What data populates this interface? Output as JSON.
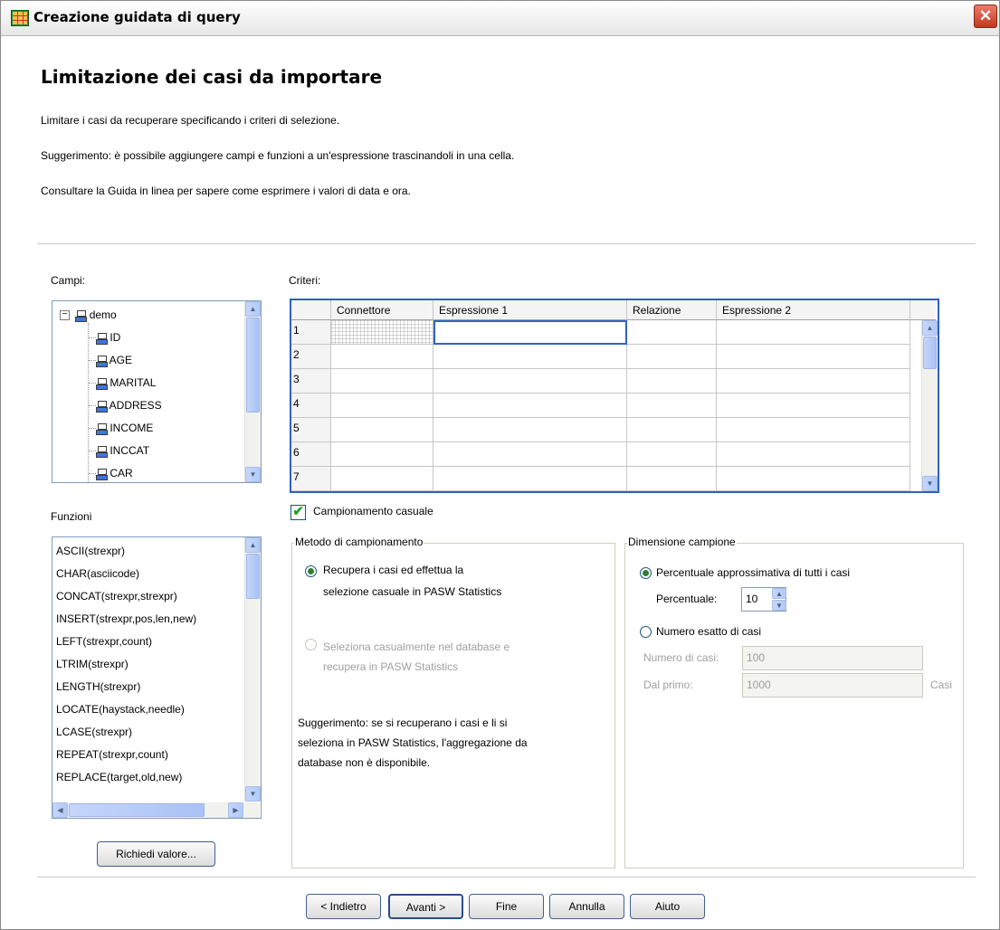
{
  "window": {
    "title": "Creazione guidata di query",
    "close_glyph": "✕"
  },
  "page": {
    "heading": "Limitazione dei casi da importare",
    "desc1": "Limitare i casi da recuperare specificando i criteri di selezione.",
    "desc2": "Suggerimento: è possibile aggiungere campi e funzioni a un'espressione trascinandoli in una cella.",
    "desc3": "Consultare la Guida in linea per sapere come esprimere i valori di data e ora."
  },
  "fields": {
    "label": "Campi:",
    "root": "demo",
    "items": [
      "ID",
      "AGE",
      "MARITAL",
      "ADDRESS",
      "INCOME",
      "INCCAT",
      "CAR"
    ]
  },
  "functions": {
    "label": "Funzioni",
    "items": [
      "ASCII(strexpr)",
      "CHAR(asciicode)",
      "CONCAT(strexpr,strexpr)",
      "INSERT(strexpr,pos,len,new)",
      "LEFT(strexpr,count)",
      "LTRIM(strexpr)",
      "LENGTH(strexpr)",
      "LOCATE(haystack,needle)",
      "LCASE(strexpr)",
      "REPEAT(strexpr,count)",
      "REPLACE(target,old,new)"
    ],
    "value_button": "Richiedi valore..."
  },
  "criteria": {
    "label": "Criteri:",
    "columns": [
      "Connettore",
      "Espressione 1",
      "Relazione",
      "Espressione 2"
    ],
    "rows": [
      "1",
      "2",
      "3",
      "4",
      "5",
      "6",
      "7"
    ]
  },
  "sampling": {
    "checkbox_label": "Campionamento casuale",
    "checked": true,
    "method": {
      "title": "Metodo di campionamento",
      "option1_line1": "Recupera i casi ed effettua la",
      "option1_line2": "selezione casuale in PASW Statistics",
      "option2_line1": "Seleziona casualmente nel database e",
      "option2_line2": "recupera in PASW Statistics",
      "hint_line1": "Suggerimento: se si recuperano i casi e li si",
      "hint_line2": "seleziona in PASW Statistics, l'aggregazione da",
      "hint_line3": "database non è disponibile."
    },
    "size": {
      "title": "Dimensione campione",
      "option1": "Percentuale approssimativa di tutti i casi",
      "percent_label": "Percentuale:",
      "percent_value": "10",
      "option2": "Numero esatto di casi",
      "num_cases_label": "Numero di casi:",
      "num_cases_value": "100",
      "from_first_label": "Dal primo:",
      "from_first_value": "1000",
      "cases_unit": "Casi"
    }
  },
  "buttons": {
    "back": "< Indietro",
    "next": "Avanti >",
    "finish": "Fine",
    "cancel": "Annulla",
    "help": "Aiuto"
  }
}
